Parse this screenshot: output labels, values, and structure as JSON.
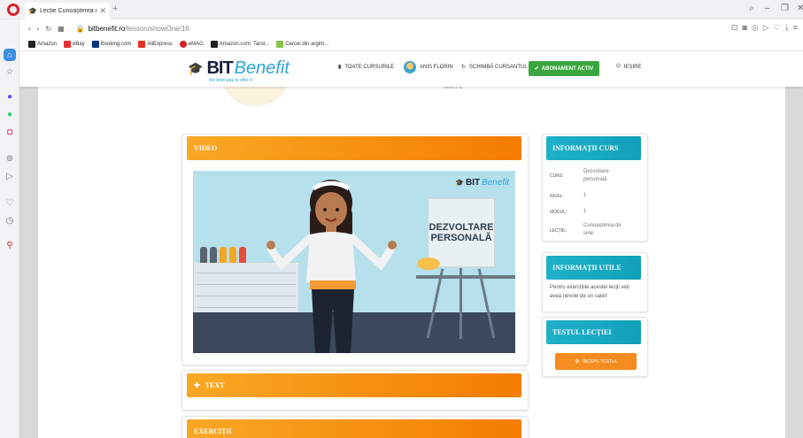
{
  "browser": {
    "tab_title": "Lecție Cunoașterea de sine",
    "url_domain": "bitbenefit.ro",
    "url_path": "/lesson/showOne/16",
    "bookmarks": [
      "Amazon",
      "eBay",
      "Booking.com",
      "AliExpress",
      "eMAG",
      "Amazon.com: Tarot...",
      "Cercei din argint..."
    ]
  },
  "header": {
    "logo_bit": "BIT",
    "logo_benefit": "Benefit",
    "logo_tagline": "the best way to offer it",
    "nav_courses": "TOATE CURSURILE",
    "nav_user": "ANIS FLORIN",
    "nav_change": "SCHIMBĂ CURSANTUL",
    "nav_subscription": "ABONAMENT ACTIV",
    "nav_logout": "IEȘIRE"
  },
  "level_label": "Nivel 1",
  "video_section": {
    "title": "VIDEO",
    "painting_text": "DEZVOLTARE PERSONALĂ",
    "video_logo_bit": "BIT",
    "video_logo_benefit": "Benefit"
  },
  "text_section": {
    "title": "TEXT"
  },
  "exercises_section": {
    "title": "EXERCIȚII"
  },
  "course_info": {
    "title": "INFORMAȚII CURS",
    "rows": [
      {
        "label": "CURS:",
        "value": "Dezvoltare personală"
      },
      {
        "label": "NIVEL:",
        "value": "1"
      },
      {
        "label": "MODUL:",
        "value": "1"
      },
      {
        "label": "LECȚIE:",
        "value": "Cunoașterea de sine"
      }
    ]
  },
  "useful_info": {
    "title": "INFORMAȚII UTILE",
    "text": "Pentru exercițiile acestei lecții veți avea nevoie de un caiet!"
  },
  "lesson_test": {
    "title": "TESTUL LECȚIEI",
    "button": "ÎNCEPE TESTUL"
  },
  "colors": {
    "orange": "#f57c00",
    "teal": "#1fb1c9",
    "green": "#3aa63f"
  }
}
